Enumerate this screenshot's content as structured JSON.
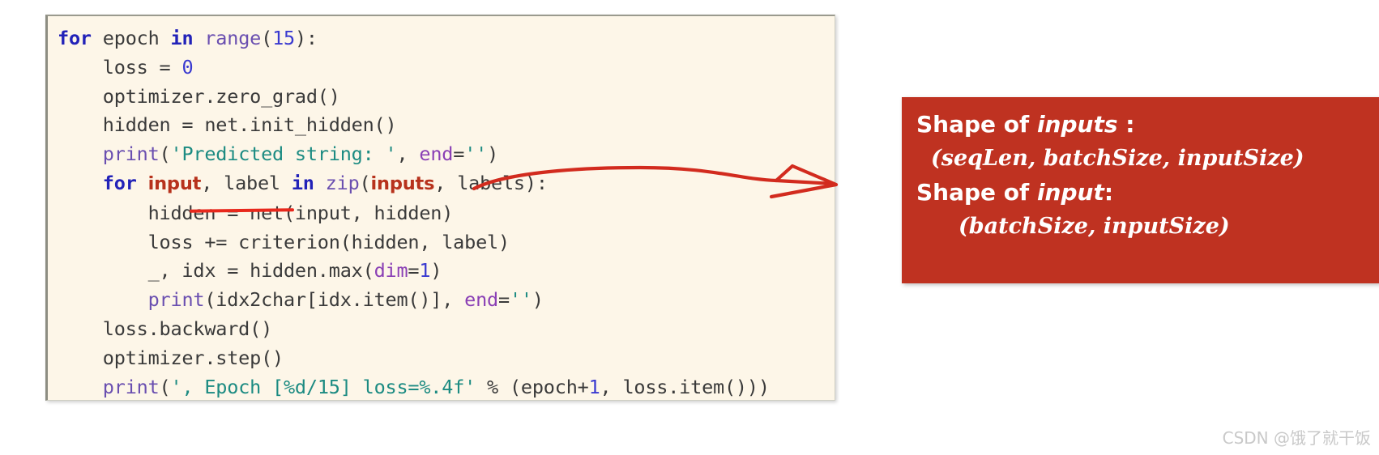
{
  "code_block": {
    "language": "python",
    "background_color": "#FDF6E8",
    "lines": [
      [
        {
          "t": "for ",
          "c": "kw"
        },
        {
          "t": "epoch ",
          "c": "plain"
        },
        {
          "t": "in ",
          "c": "kw"
        },
        {
          "t": "range",
          "c": "fn"
        },
        {
          "t": "(",
          "c": "plain"
        },
        {
          "t": "15",
          "c": "num"
        },
        {
          "t": "):",
          "c": "plain"
        }
      ],
      [
        {
          "t": "    loss = ",
          "c": "plain"
        },
        {
          "t": "0",
          "c": "num"
        }
      ],
      [
        {
          "t": "    optimizer.zero_grad()",
          "c": "plain"
        }
      ],
      [
        {
          "t": "    hidden = net.init_hidden()",
          "c": "plain"
        }
      ],
      [
        {
          "t": "    ",
          "c": "plain"
        },
        {
          "t": "print",
          "c": "fn"
        },
        {
          "t": "(",
          "c": "plain"
        },
        {
          "t": "'Predicted string: '",
          "c": "str"
        },
        {
          "t": ", ",
          "c": "plain"
        },
        {
          "t": "end",
          "c": "kwarg"
        },
        {
          "t": "=",
          "c": "plain"
        },
        {
          "t": "''",
          "c": "str"
        },
        {
          "t": ")",
          "c": "plain"
        }
      ],
      [
        {
          "t": "    ",
          "c": "plain"
        },
        {
          "t": "for ",
          "c": "kw"
        },
        {
          "t": "input",
          "c": "hl"
        },
        {
          "t": ", label ",
          "c": "plain"
        },
        {
          "t": "in ",
          "c": "kw"
        },
        {
          "t": "zip",
          "c": "fn"
        },
        {
          "t": "(",
          "c": "plain"
        },
        {
          "t": "inputs",
          "c": "hl"
        },
        {
          "t": ", labels):",
          "c": "plain"
        }
      ],
      [
        {
          "t": "        hidden = net(input, hidden)",
          "c": "plain"
        }
      ],
      [
        {
          "t": "        loss += criterion(hidden, label)",
          "c": "plain"
        }
      ],
      [
        {
          "t": "        _, idx = hidden.max(",
          "c": "plain"
        },
        {
          "t": "dim",
          "c": "kwarg"
        },
        {
          "t": "=",
          "c": "plain"
        },
        {
          "t": "1",
          "c": "num"
        },
        {
          "t": ")",
          "c": "plain"
        }
      ],
      [
        {
          "t": "        ",
          "c": "plain"
        },
        {
          "t": "print",
          "c": "fn"
        },
        {
          "t": "(idx2char[idx.item()], ",
          "c": "plain"
        },
        {
          "t": "end",
          "c": "kwarg"
        },
        {
          "t": "=",
          "c": "plain"
        },
        {
          "t": "''",
          "c": "str"
        },
        {
          "t": ")",
          "c": "plain"
        }
      ],
      [
        {
          "t": "    loss.backward()",
          "c": "plain"
        }
      ],
      [
        {
          "t": "    optimizer.step()",
          "c": "plain"
        }
      ],
      [
        {
          "t": "    ",
          "c": "plain"
        },
        {
          "t": "print",
          "c": "fn"
        },
        {
          "t": "(",
          "c": "plain"
        },
        {
          "t": "', Epoch [%d/15] loss=%.4f'",
          "c": "str"
        },
        {
          "t": " % (epoch+",
          "c": "plain"
        },
        {
          "t": "1",
          "c": "num"
        },
        {
          "t": ", loss.item()))",
          "c": "plain"
        }
      ]
    ],
    "highlighted_tokens": [
      "input",
      "inputs"
    ],
    "underlined_token": "input"
  },
  "annotation": {
    "arrow_color": "#D22B1E",
    "arrow_description": "hand-drawn wavy arrow pointing right from the 'for input' line to the callout box"
  },
  "callout": {
    "background_color": "#BF3221",
    "text_color": "#FFFFFF",
    "line1_prefix": "Shape of ",
    "line1_var": "inputs",
    "line1_suffix": " :",
    "line2": "(seqLen, batchSize, inputSize)",
    "line3_prefix": "Shape of ",
    "line3_var": "input",
    "line3_suffix": ":",
    "line4": "(batchSize, inputSize)"
  },
  "watermark": {
    "text": "CSDN @饿了就干饭"
  }
}
